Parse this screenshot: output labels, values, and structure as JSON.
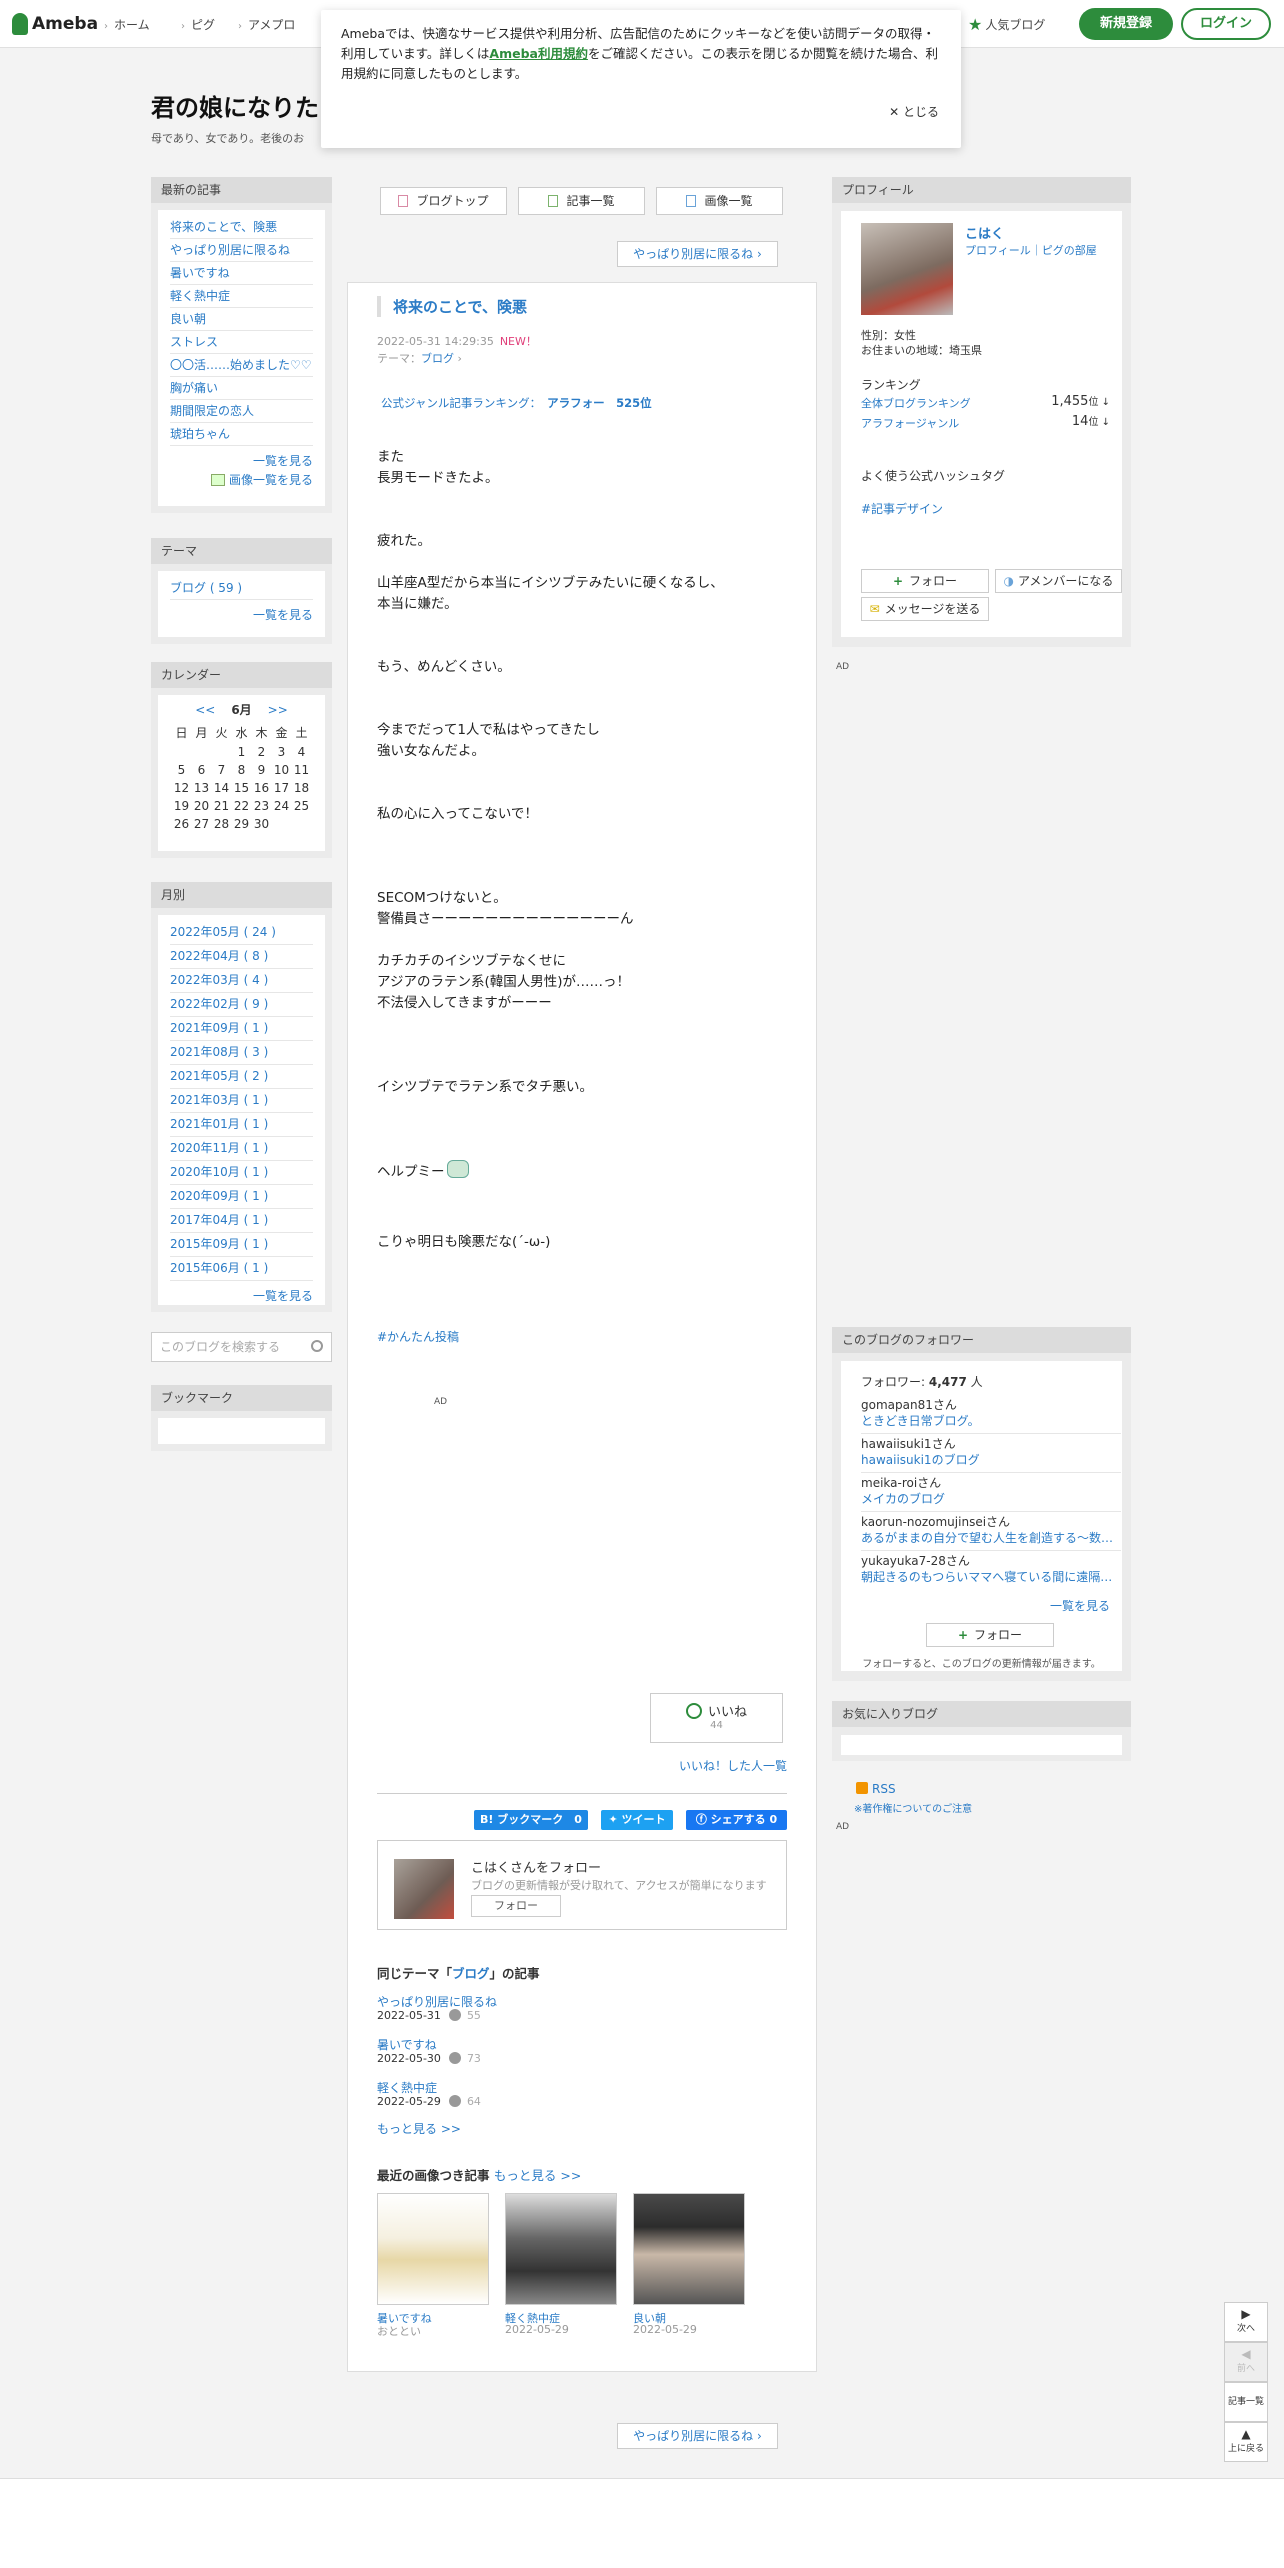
{
  "header": {
    "logo": "Ameba",
    "nav": [
      "ホーム",
      "ピグ",
      "アメプロ"
    ],
    "popular": "人気ブログ",
    "register": "新規登録",
    "login": "ログイン"
  },
  "cookie": {
    "text1": "Amebaでは、快適なサービス提供や利用分析、広告配信のためにクッキーなどを使い訪問データの取得・利用しています。詳しくは",
    "policy": "Ameba利用規約",
    "text2": "をご確認ください。この表示を閉じるか閲覧を続けた場合、利用規約に同意したものとします。",
    "close": "とじる"
  },
  "blog": {
    "title": "君の娘になりた",
    "desc": "母であり、女であり。老後のお"
  },
  "left": {
    "latest_head": "最新の記事",
    "latest": [
      "将来のことで、険悪",
      "やっぱり別居に限るね",
      "暑いですね",
      "軽く熱中症",
      "良い朝",
      "ストレス",
      "〇〇活……始めました♡♡",
      "胸が痛い",
      "期間限定の恋人",
      "琥珀ちゃん"
    ],
    "latest_more": "一覧を見る",
    "latest_images": "画像一覧を見る",
    "theme_head": "テーマ",
    "theme_item": "ブログ ( 59 )",
    "theme_more": "一覧を見る",
    "cal_head": "カレンダー",
    "cal_prev": "<<",
    "cal_month": "6月",
    "cal_next": ">>",
    "cal_days": [
      "日",
      "月",
      "火",
      "水",
      "木",
      "金",
      "土"
    ],
    "cal_cells": [
      "",
      "",
      "",
      "1",
      "2",
      "3",
      "4",
      "5",
      "6",
      "7",
      "8",
      "9",
      "10",
      "11",
      "12",
      "13",
      "14",
      "15",
      "16",
      "17",
      "18",
      "19",
      "20",
      "21",
      "22",
      "23",
      "24",
      "25",
      "26",
      "27",
      "28",
      "29",
      "30",
      "",
      ""
    ],
    "monthly_head": "月別",
    "monthly": [
      "2022年05月 ( 24 )",
      "2022年04月 ( 8 )",
      "2022年03月 ( 4 )",
      "2022年02月 ( 9 )",
      "2021年09月 ( 1 )",
      "2021年08月 ( 3 )",
      "2021年05月 ( 2 )",
      "2021年03月 ( 1 )",
      "2021年01月 ( 1 )",
      "2020年11月 ( 1 )",
      "2020年10月 ( 1 )",
      "2020年09月 ( 1 )",
      "2017年04月 ( 1 )",
      "2015年09月 ( 1 )",
      "2015年06月 ( 1 )"
    ],
    "monthly_more": "一覧を見る",
    "search_placeholder": "このブログを検索する",
    "bookmark_head": "ブックマーク"
  },
  "center": {
    "tab_top": "ブログトップ",
    "tab_list": "記事一覧",
    "tab_images": "画像一覧",
    "next": "やっぱり別居に限るね",
    "entry_title": "将来のことで、険悪",
    "entry_date": "2022-05-31 14:29:35",
    "entry_new": "NEW！",
    "entry_theme_label": "テーマ：",
    "entry_theme": "ブログ",
    "ranking_label": "公式ジャンル記事ランキング：",
    "ranking_value": "アラフォー　525位",
    "body": [
      "また",
      "長男モードきたよ。",
      "疲れた。",
      "山羊座A型だから本当にイシツブテみたいに硬くなるし、",
      "本当に嫌だ。",
      "もう、めんどくさい。",
      "今までだって1人で私はやってきたし",
      "強い女なんだよ。",
      "私の心に入ってこないで！",
      "SECOMつけないと。",
      "警備員さーーーーーーーーーーーーーーん",
      "カチカチのイシツブテなくせに",
      "アジアのラテン系(韓国人男性)が……っ！",
      "不法侵入してきますがーーー",
      "イシツブテでラテン系でタチ悪い。",
      "ヘルプミー",
      "こりゃ明日も険悪だな(´-ω-)"
    ],
    "hashtag": "#かんたん投稿",
    "ad": "AD",
    "like": "いいね",
    "like_count": "44",
    "like_list": "いいね！した人一覧",
    "share_hatena": "B! ブックマーク　0",
    "share_tweet": "ツイート",
    "share_fb": "シェアする 0",
    "follow_name": "こはくさんをフォロー",
    "follow_sub": "ブログの更新情報が受け取れて、アクセスが簡単になります",
    "follow_btn": "フォロー",
    "same_theme_pre": "同じテーマ「",
    "same_theme_name": "ブログ",
    "same_theme_post": "」の記事",
    "related": [
      {
        "title": "やっぱり別居に限るね",
        "date": "2022-05-31",
        "count": "55"
      },
      {
        "title": "暑いですね",
        "date": "2022-05-30",
        "count": "73"
      },
      {
        "title": "軽く熱中症",
        "date": "2022-05-29",
        "count": "64"
      }
    ],
    "more": "もっと見る >>",
    "img_head": "最近の画像つき記事",
    "img_more": "もっと見る >>",
    "images": [
      {
        "title": "暑いですね",
        "date": "おととい"
      },
      {
        "title": "軽く熱中症",
        "date": "2022-05-29"
      },
      {
        "title": "良い朝",
        "date": "2022-05-29"
      }
    ]
  },
  "right": {
    "profile_head": "プロフィール",
    "name": "こはく",
    "links": "プロフィール｜ピグの部屋",
    "gender": "性別：女性",
    "region": "お住まいの地域：埼玉県",
    "ranking_head": "ランキング",
    "rank_all_label": "全体ブログランキング",
    "rank_all": "1,455",
    "rank_genre_label": "アラフォージャンル",
    "rank_genre": "14",
    "rank_unit": "位 ↓",
    "hashtag_head": "よく使う公式ハッシュタグ",
    "hashtag": "#記事デザイン",
    "follow_btn": "フォロー",
    "member_btn": "アメンバーになる",
    "message_btn": "メッセージを送る",
    "ad": "AD",
    "followers_head": "このブログのフォロワー",
    "followers_label": "フォロワー: ",
    "followers_count": "4,477",
    "followers_unit": " 人",
    "followers": [
      {
        "user": "gomapan81さん",
        "blog": "ときどき日常ブログ。"
      },
      {
        "user": "hawaiisuki1さん",
        "blog": "hawaiisuki1のブログ"
      },
      {
        "user": "meika-roiさん",
        "blog": "メイカのブログ"
      },
      {
        "user": "kaorun-nozomujinseiさん",
        "blog": "あるがままの自分で望む人生を創造する～数…"
      },
      {
        "user": "yukayuka7-28さん",
        "blog": "朝起きるのもつらいママへ寝ている間に遠隔…"
      }
    ],
    "followers_more": "一覧を見る",
    "follow_btn2": "フォロー",
    "follow_note": "フォローすると、このブログの更新情報が届きます。",
    "fav_head": "お気に入りブログ",
    "rss": "RSS",
    "copyright": "※著作権についてのご注意",
    "ad2": "AD"
  },
  "pager": {
    "next": "次へ",
    "prev": "前へ",
    "list": "記事一覧",
    "top": "上に戻る"
  }
}
